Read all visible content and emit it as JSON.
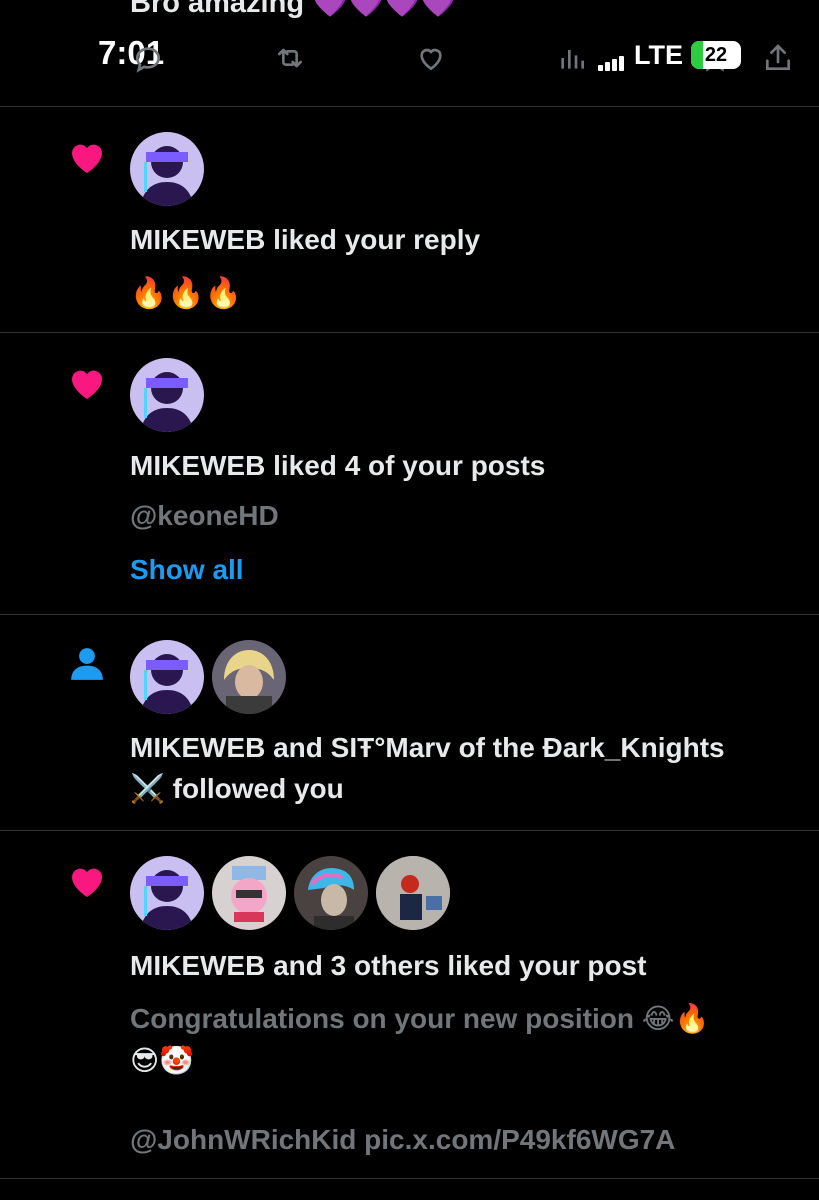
{
  "top_post": {
    "text": "Bro amazing",
    "emojis": "💜💜💜💜"
  },
  "status_bar": {
    "time": "7:01",
    "network": "LTE",
    "battery": "22"
  },
  "notifications": [
    {
      "type": "like",
      "headline": "MIKEWEB liked your reply",
      "body": "🔥🔥🔥"
    },
    {
      "type": "like",
      "headline": "MIKEWEB liked 4 of your posts",
      "handle": "@keoneHD",
      "show_all": "Show all"
    },
    {
      "type": "follow",
      "headline_line1": "MIKEWEB and SIŦ°Marv of the Đark_Knights",
      "headline_line2": "⚔️ followed you"
    },
    {
      "type": "like",
      "headline": "MIKEWEB and 3 others liked your post",
      "body_line1": "Congratulations on your new position 😂🔥",
      "body_line2": "😎🤡",
      "body_link": "@JohnWRichKid pic.x.com/P49kf6WG7A"
    }
  ],
  "colors": {
    "like": "#f91880",
    "follow": "#1d9bf0",
    "link": "#1d9bf0",
    "muted": "#71767b"
  }
}
